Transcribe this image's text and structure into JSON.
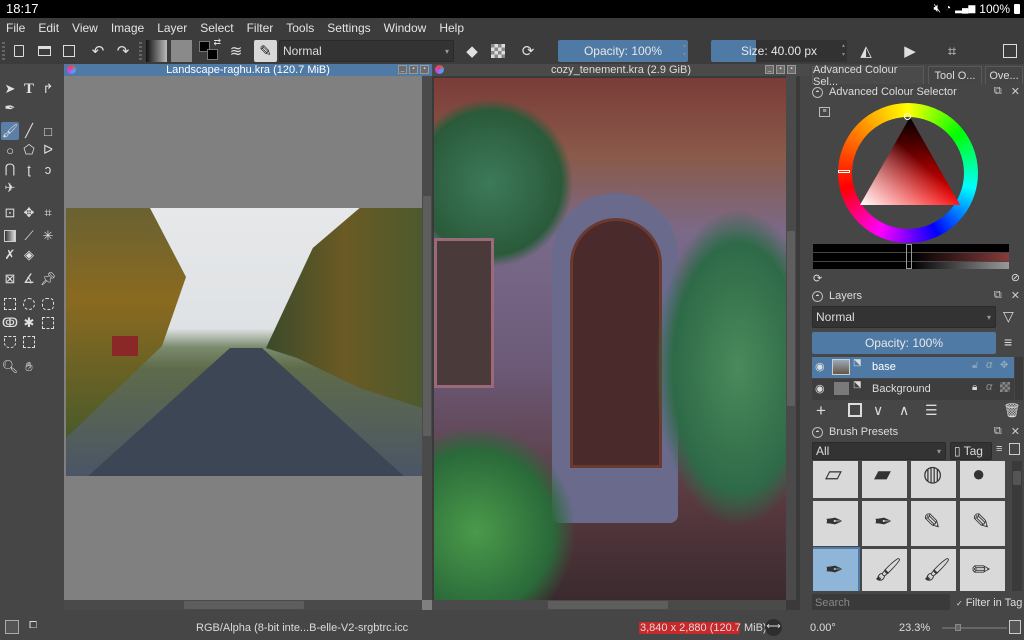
{
  "android_status": {
    "time": "18:17",
    "battery": "100%",
    "icons": [
      "mute-icon",
      "wifi-icon",
      "signal-icon",
      "battery-icon"
    ]
  },
  "menu": [
    "File",
    "Edit",
    "View",
    "Image",
    "Layer",
    "Select",
    "Filter",
    "Tools",
    "Settings",
    "Window",
    "Help"
  ],
  "toolbar": {
    "blend_mode": "Normal",
    "opacity_label": "Opacity: 100%",
    "opacity_value": 100,
    "size_label": "Size: 40.00 px",
    "size_fill": 0.33
  },
  "documents": [
    {
      "title": "Landscape-raghu.kra (120.7 MiB)",
      "active": true
    },
    {
      "title": "cozy_tenement.kra (2.9 GiB)",
      "active": false
    }
  ],
  "dock": {
    "tabs": [
      "Advanced Colour Sel...",
      "Tool O...",
      "Ove..."
    ],
    "colour_selector": {
      "title": "Advanced Colour Selector",
      "current_color": "#000000",
      "hue_color": "#ff0000"
    },
    "layers": {
      "title": "Layers",
      "blend_mode": "Normal",
      "opacity_label": "Opacity:  100%",
      "items": [
        {
          "name": "base",
          "selected": true,
          "locked": false
        },
        {
          "name": "Background",
          "selected": false,
          "locked": true
        }
      ]
    },
    "brush_presets": {
      "title": "Brush Presets",
      "tag_filter": "All",
      "tag_button": "Tag",
      "search_placeholder": "Search",
      "filter_in_tag_label": "Filter in Tag",
      "filter_in_tag_checked": true,
      "presets": [
        "eraser-hard",
        "eraser-soft",
        "eraser-airbrush",
        "airbrush-soft",
        "ink-pen-round",
        "ink-pen-dry",
        "pencil-texture",
        "pencil-soft",
        "ink-brush-blue",
        "paint-brush-round",
        "paint-brush-flat",
        "pencil-blue"
      ],
      "selected_index": 8
    }
  },
  "statusbar": {
    "color_profile": "RGB/Alpha (8-bit inte...B-elle-V2-srgbtrc.icc",
    "dimensions": "3,840 x 2,880 (120.7 MiB)",
    "rotation": "0.00°",
    "zoom": "23.3%",
    "zoom_slider_fraction": 0.2
  }
}
